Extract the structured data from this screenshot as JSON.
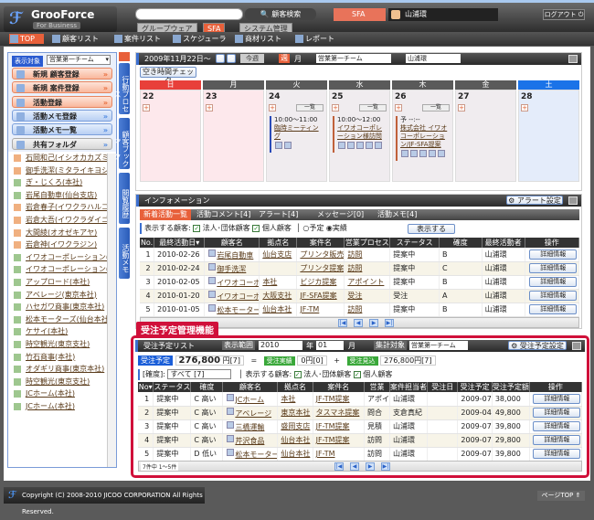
{
  "header": {
    "logo_name": "GrooForce",
    "logo_sub": "For Business",
    "search_button": "顧客検索",
    "tabs": [
      "グループウェア",
      "SFA",
      "システム管理"
    ],
    "app_badge": "SFA",
    "user": "山浦環",
    "logout": "ログアウト"
  },
  "nav": [
    "TOP",
    "顧客リスト",
    "案件リスト",
    "スケジューラ",
    "商材リスト",
    "レポート"
  ],
  "left": {
    "scope_label": "表示対象",
    "scope_value": "営業第一チーム",
    "buttons": [
      "新規 顧客登録",
      "新規 案件登録",
      "活動登録",
      "活動メモ登録",
      "活動メモ一覧",
      "共有フォルダ"
    ],
    "customers": [
      {
        "n": "石岡和己(イシオカカズミ)",
        "t": "p"
      },
      {
        "n": "御手洗潔(ミタライキヨシ)",
        "t": "p"
      },
      {
        "n": "ぎ・じくろ(本社)",
        "t": "c"
      },
      {
        "n": "岩尾自動車(仙台支店)",
        "t": "c"
      },
      {
        "n": "岩倉春子(イワクラハルコ)",
        "t": "p"
      },
      {
        "n": "岩倉大吾(イワクラダイゴ)",
        "t": "p"
      },
      {
        "n": "大間綾(オオゼキアヤ)",
        "t": "p"
      },
      {
        "n": "岩倉神(イワクラジン)",
        "t": "p"
      },
      {
        "n": "イワオコーポレーション(本社)",
        "t": "c"
      },
      {
        "n": "イワオコーポレーション(大阪支社)",
        "t": "c"
      },
      {
        "n": "アップロード(本社)",
        "t": "c"
      },
      {
        "n": "アベレージ(東京本社)",
        "t": "c"
      },
      {
        "n": "ハセガワ商事(東京本社)",
        "t": "c"
      },
      {
        "n": "松本モーターズ(仙台本社)",
        "t": "c"
      },
      {
        "n": "ケサイ(本社)",
        "t": "c"
      },
      {
        "n": "時空観光(東京支社)",
        "t": "c"
      },
      {
        "n": "竹石商事(本社)",
        "t": "c"
      },
      {
        "n": "オダギリ商事(東京本社)",
        "t": "c"
      },
      {
        "n": "時空観光(東京支社)",
        "t": "c"
      },
      {
        "n": "JCホーム(本社)",
        "t": "c"
      },
      {
        "n": "JCホーム(本社)",
        "t": "c"
      }
    ],
    "vtabs": [
      "行動プロセス",
      "顧客ブックマーク",
      "閲覧履歴",
      "活動メモ"
    ]
  },
  "calendar": {
    "date": "2009年11月22日～",
    "this_week": "今週",
    "week": "週",
    "month": "月",
    "team": "営業第一チーム",
    "person": "山浦環",
    "free_check": "空き時間チェック",
    "more": "一覧",
    "days": [
      {
        "w": "日",
        "d": "22",
        "color": "#e8403a",
        "bg": "#fde8ec"
      },
      {
        "w": "月",
        "d": "23",
        "color": "#5a5a5a",
        "bg": "#fde8ec"
      },
      {
        "w": "火",
        "d": "24",
        "color": "#5a5a5a",
        "bg": "#f0ecef"
      },
      {
        "w": "水",
        "d": "25",
        "color": "#5a5a5a",
        "bg": "#f0ecef"
      },
      {
        "w": "木",
        "d": "26",
        "color": "#5a5a5a",
        "bg": "#f0ecef"
      },
      {
        "w": "金",
        "d": "27",
        "color": "#5a5a5a",
        "bg": "#f0ecef"
      },
      {
        "w": "土",
        "d": "28",
        "color": "#1a73e8",
        "bg": "#e4ecfa"
      }
    ],
    "events": [
      {
        "day": 2,
        "time": "10:00～11:00",
        "title": "臨時ミーティング"
      },
      {
        "day": 3,
        "time": "10:00～12:00",
        "title": "イワオコーポレーション様訪問"
      },
      {
        "day": 4,
        "time": "予 --:--",
        "title": "株式会社 イワオコーポレーション/JF-SFA提案"
      }
    ]
  },
  "info": {
    "title": "インフォメーション",
    "alert_settings": "アラート設定",
    "tabs": [
      "新着活動一覧",
      "活動コメント[4]",
      "アラート[4]",
      "メッセージ[0]",
      "活動メモ[4]"
    ],
    "filter_label": "表示する顧客:",
    "corp": "法人･団体顧客",
    "indiv": "個人顧客",
    "plan": "予定",
    "actual": "実績",
    "show": "表示する",
    "columns": [
      "No.",
      "最終活動日▾",
      "顧客名",
      "拠点名",
      "案件名",
      "営業プロセス",
      "ステータス",
      "確度",
      "最終活動者",
      "操作"
    ],
    "rows": [
      [
        "1",
        "2010-02-26",
        "岩尾自動車",
        "仙台支店",
        "プリンタ販売",
        "訪問",
        "提案中",
        "B",
        "山浦環"
      ],
      [
        "2",
        "2010-02-24",
        "御手洗潔",
        "",
        "プリンタ提案",
        "訪問",
        "提案中",
        "C",
        "山浦環"
      ],
      [
        "3",
        "2010-02-05",
        "イワオコーポ",
        "本社",
        "ビジカ提案",
        "アポイント",
        "提案中",
        "B",
        "山浦環"
      ],
      [
        "4",
        "2010-01-20",
        "イワオコーポ",
        "大阪支社",
        "JF-SFA提案",
        "受注",
        "受注",
        "A",
        "山浦環"
      ],
      [
        "5",
        "2010-01-05",
        "松本モーターズ",
        "仙台本社",
        "JF-TM",
        "訪問",
        "提案中",
        "B",
        "山浦環"
      ]
    ],
    "detail": "詳細情報"
  },
  "orders": {
    "label": "受注予定管理機能",
    "title": "受注予定リスト",
    "range_label": "表示範囲",
    "year": "2010",
    "year_unit": "年",
    "month": "01",
    "month_unit": "月",
    "target_label": "集計対象",
    "target": "営業第一チーム",
    "settings": "受注予定設定",
    "planned_label": "受注予定",
    "planned": "276,800",
    "planned_unit": "円[7]",
    "eq": "=",
    "actual_label": "受注実績",
    "actual": "0円[0]",
    "plus": "+",
    "forecast_label": "受注見込",
    "forecast": "276,800円[7]",
    "certainty_label": "[確度]:",
    "certainty": "すべて [7]",
    "filter_label": "表示する顧客:",
    "corp": "法人･団体顧客",
    "indiv": "個人顧客",
    "columns": [
      "No▾",
      "ステータス",
      "確度",
      "顧客名",
      "拠点名",
      "案件名",
      "営業",
      "案件担当者",
      "受注日",
      "受注予定",
      "受注予定額",
      "操作"
    ],
    "rows": [
      [
        "1",
        "提案中",
        "C 高い",
        "JCホーム",
        "本社",
        "JF-TM提案",
        "アポイ",
        "山浦環",
        "",
        "2009-07",
        "38,000"
      ],
      [
        "2",
        "提案中",
        "C 高い",
        "アベレージ",
        "東京本社",
        "タスマネ提案",
        "問合",
        "支倉真紀",
        "",
        "2009-04",
        "49,800"
      ],
      [
        "3",
        "提案中",
        "C 高い",
        "三橋運輸",
        "盛岡支店",
        "JF-TM提案",
        "見積",
        "山浦環",
        "",
        "2009-07",
        "39,800"
      ],
      [
        "4",
        "提案中",
        "C 高い",
        "芹沢食品",
        "仙台本社",
        "JF-TM提案",
        "訪問",
        "山浦環",
        "",
        "2009-07",
        "29,800"
      ],
      [
        "5",
        "提案中",
        "D 低い",
        "松本モーターズ",
        "仙台本社",
        "JF-TM",
        "訪問",
        "山浦環",
        "",
        "2009-07",
        "39,800"
      ]
    ],
    "detail": "詳細情報",
    "count": "7件中 1～5件"
  },
  "footer": {
    "copyright": "Copyright (C) 2008-2010 JICOO CORPORATION All Rights Reserved.",
    "page_top": "ページTOP"
  },
  "colors": {
    "accent_red": "#d0103a",
    "orange": "#e8735a",
    "blue": "#2a5bb8"
  }
}
